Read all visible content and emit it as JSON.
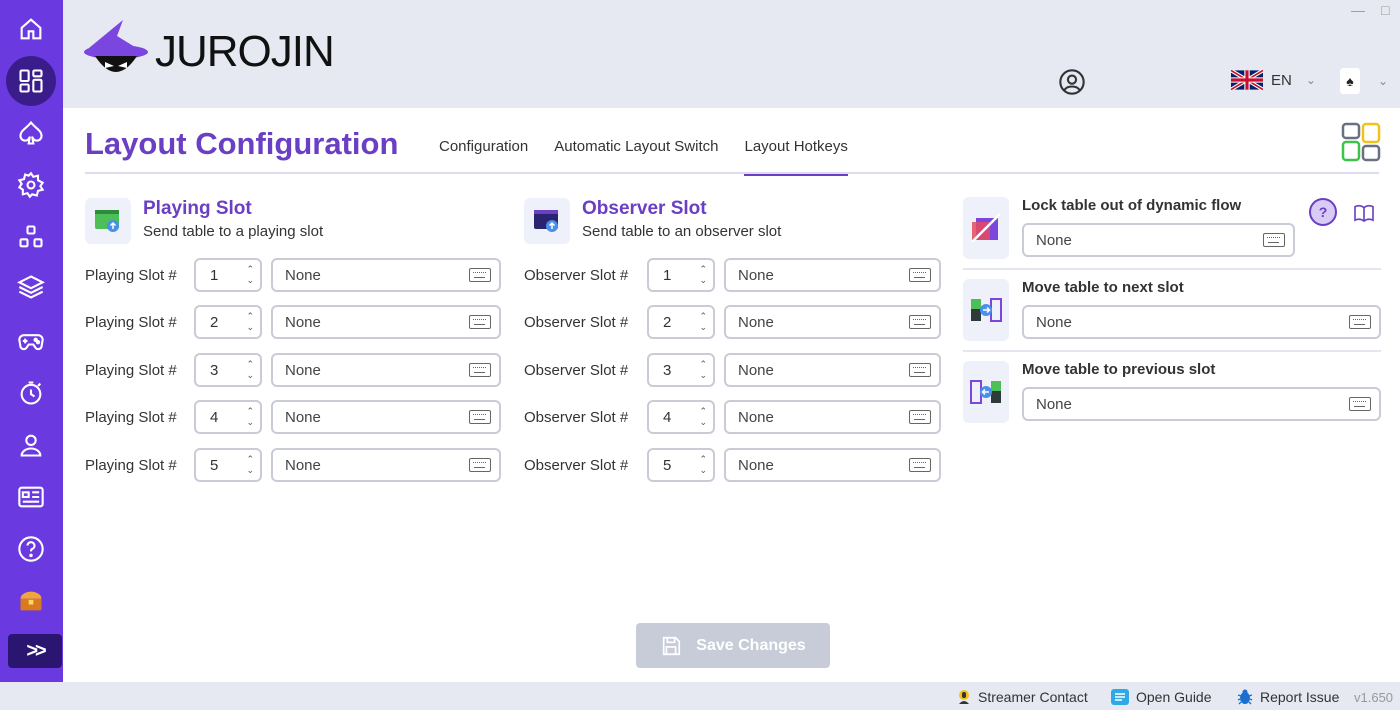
{
  "app": {
    "brand": "JUROJIN"
  },
  "header": {
    "language": "EN",
    "window_controls": [
      "—",
      "□"
    ]
  },
  "sidebar": {
    "items": [
      {
        "icon": "home-icon"
      },
      {
        "icon": "layout-grid-icon",
        "active": true
      },
      {
        "icon": "spade-icon"
      },
      {
        "icon": "gear-icon"
      },
      {
        "icon": "tiles-icon"
      },
      {
        "icon": "layers-icon"
      },
      {
        "icon": "gamepad-icon"
      },
      {
        "icon": "stopwatch-icon"
      },
      {
        "icon": "user-icon"
      },
      {
        "icon": "news-icon"
      },
      {
        "icon": "help-circle-icon"
      },
      {
        "icon": "treasure-chest-icon"
      }
    ],
    "expand_label": ">>"
  },
  "page": {
    "title": "Layout Configuration",
    "tabs": [
      {
        "label": "Configuration",
        "active": false
      },
      {
        "label": "Automatic Layout Switch",
        "active": false
      },
      {
        "label": "Layout Hotkeys",
        "active": true
      }
    ]
  },
  "playing": {
    "title": "Playing Slot",
    "subtitle": "Send table to a playing slot",
    "row_label": "Playing Slot #",
    "rows": [
      {
        "slot": "1",
        "hotkey": "None"
      },
      {
        "slot": "2",
        "hotkey": "None"
      },
      {
        "slot": "3",
        "hotkey": "None"
      },
      {
        "slot": "4",
        "hotkey": "None"
      },
      {
        "slot": "5",
        "hotkey": "None"
      }
    ]
  },
  "observer": {
    "title": "Observer Slot",
    "subtitle": "Send table to an observer slot",
    "row_label": "Observer Slot #",
    "rows": [
      {
        "slot": "1",
        "hotkey": "None"
      },
      {
        "slot": "2",
        "hotkey": "None"
      },
      {
        "slot": "3",
        "hotkey": "None"
      },
      {
        "slot": "4",
        "hotkey": "None"
      },
      {
        "slot": "5",
        "hotkey": "None"
      }
    ]
  },
  "actions": [
    {
      "label": "Lock table out of dynamic flow",
      "hotkey": "None"
    },
    {
      "label": "Move table to next slot",
      "hotkey": "None"
    },
    {
      "label": "Move table to previous slot",
      "hotkey": "None"
    }
  ],
  "help_label": "?",
  "save_label": "Save Changes",
  "footer": {
    "streamer": "Streamer Contact",
    "guide": "Open Guide",
    "report": "Report Issue",
    "version": "v1.650"
  },
  "colors": {
    "accent": "#6a3fc4",
    "sidebar": "#6a3ae0",
    "save_disabled": "#c7ccd8"
  }
}
